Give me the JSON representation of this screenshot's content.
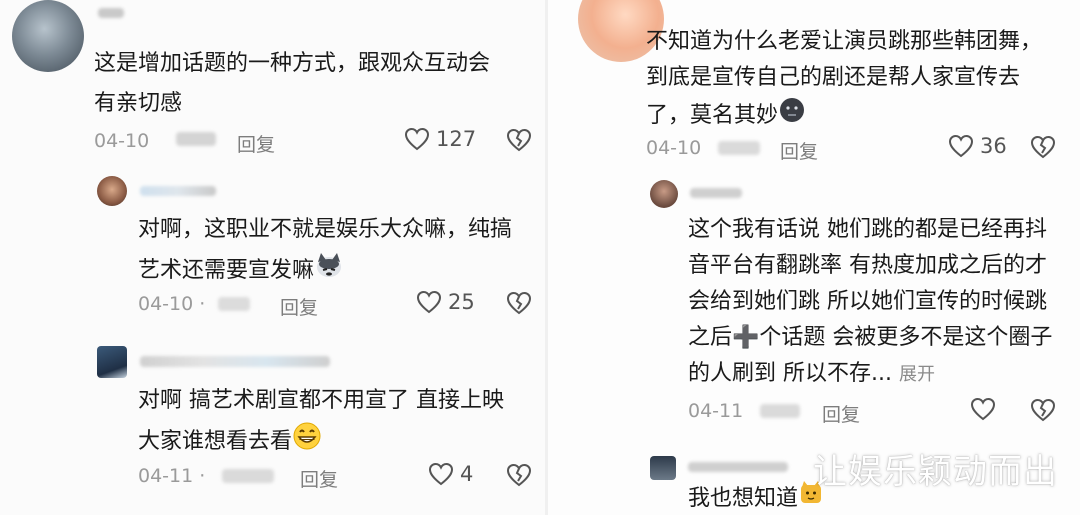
{
  "left": {
    "comments": [
      {
        "text_lines": [
          "这是增加话题的一种方式，跟观众互动会",
          "有亲切感"
        ],
        "date": "04-10",
        "reply_label": "回复",
        "likes": "127"
      },
      {
        "text_lines": [
          "对啊，这职业不就是娱乐大众嘛，纯搞",
          "艺术还需要宣发嘛"
        ],
        "date": "04-10 ·",
        "reply_label": "回复",
        "likes": "25"
      },
      {
        "text_lines": [
          "对啊 搞艺术剧宣都不用宣了  直接上映",
          "大家谁想看去看"
        ],
        "date": "04-11 ·",
        "reply_label": "回复",
        "likes": "4"
      }
    ]
  },
  "right": {
    "comments": [
      {
        "text_lines": [
          "不知道为什么老爱让演员跳那些韩团舞，",
          "到底是宣传自己的剧还是帮人家宣传去",
          "了，莫名其妙"
        ],
        "date": "04-10",
        "reply_label": "回复",
        "likes": "36"
      },
      {
        "text_lines": [
          "这个我有话说 她们跳的都是已经再抖",
          "音平台有翻跳率 有热度加成之后的才",
          "会给到她们跳 所以她们宣传的时候跳",
          "之后➕个话题 会被更多不是这个圈子",
          "的人刷到 所以不存..."
        ],
        "expand_label": "展开",
        "date": "04-11",
        "reply_label": "回复",
        "likes": ""
      },
      {
        "text_lines": [
          "我也想知道"
        ]
      }
    ]
  },
  "watermark": "让娱乐颖动而出",
  "colors": {
    "text": "#1a1a1a",
    "meta": "#9a9a9a",
    "icon": "#555555"
  },
  "icons": [
    "heart-outline-icon",
    "broken-heart-icon",
    "grin-emoji",
    "dog-emoji",
    "black-face-emoji",
    "cat-emoji",
    "plus-icon"
  ]
}
